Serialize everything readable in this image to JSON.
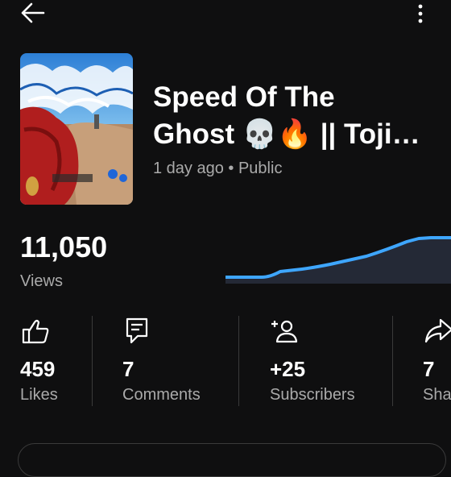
{
  "video": {
    "title_line1": "Speed Of The",
    "title_line2": "Ghost 💀🔥 || Toji…",
    "meta": "1 day ago • Public"
  },
  "views": {
    "count": "11,050",
    "label": "Views"
  },
  "stats": [
    {
      "value": "459",
      "label": "Likes",
      "icon": "thumbs-up-icon"
    },
    {
      "value": "7",
      "label": "Comments",
      "icon": "comment-icon"
    },
    {
      "value": "+25",
      "label": "Subscribers",
      "icon": "add-person-icon"
    },
    {
      "value": "7",
      "label": "Shares",
      "icon": "share-icon"
    }
  ],
  "colors": {
    "background": "#0f0f10",
    "accent_line": "#3ea6ff",
    "secondary_text": "#aaaaaa"
  }
}
